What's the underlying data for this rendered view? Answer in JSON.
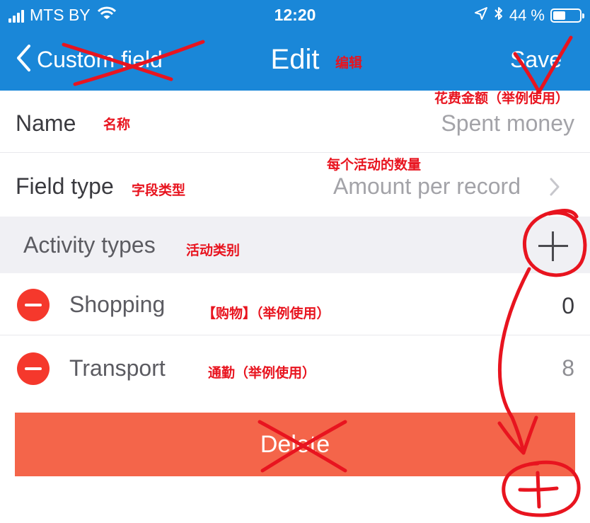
{
  "status_bar": {
    "carrier": "MTS BY",
    "time": "12:20",
    "battery": "44 %"
  },
  "nav": {
    "back_label": "Custom field",
    "title": "Edit",
    "save_label": "Save"
  },
  "rows": {
    "name": {
      "label": "Name",
      "value": "Spent money"
    },
    "field_type": {
      "label": "Field type",
      "value": "Amount per record"
    }
  },
  "section": {
    "title": "Activity types"
  },
  "activities": [
    {
      "name": "Shopping",
      "count": "0"
    },
    {
      "name": "Transport",
      "count": "8"
    }
  ],
  "delete_label": "Delete",
  "annotations": {
    "edit": "编辑",
    "save": "花费金额（举例使用）",
    "name": "名称",
    "field_value": "每个活动的数量",
    "field_type": "字段类型",
    "activity_types": "活动类别",
    "shopping": "【购物】（举例使用）",
    "transport": "通勤（举例使用）"
  },
  "colors": {
    "header": "#1a87d8",
    "delete": "#f4654a",
    "minus": "#f5382c",
    "annotation": "#e8141f"
  }
}
